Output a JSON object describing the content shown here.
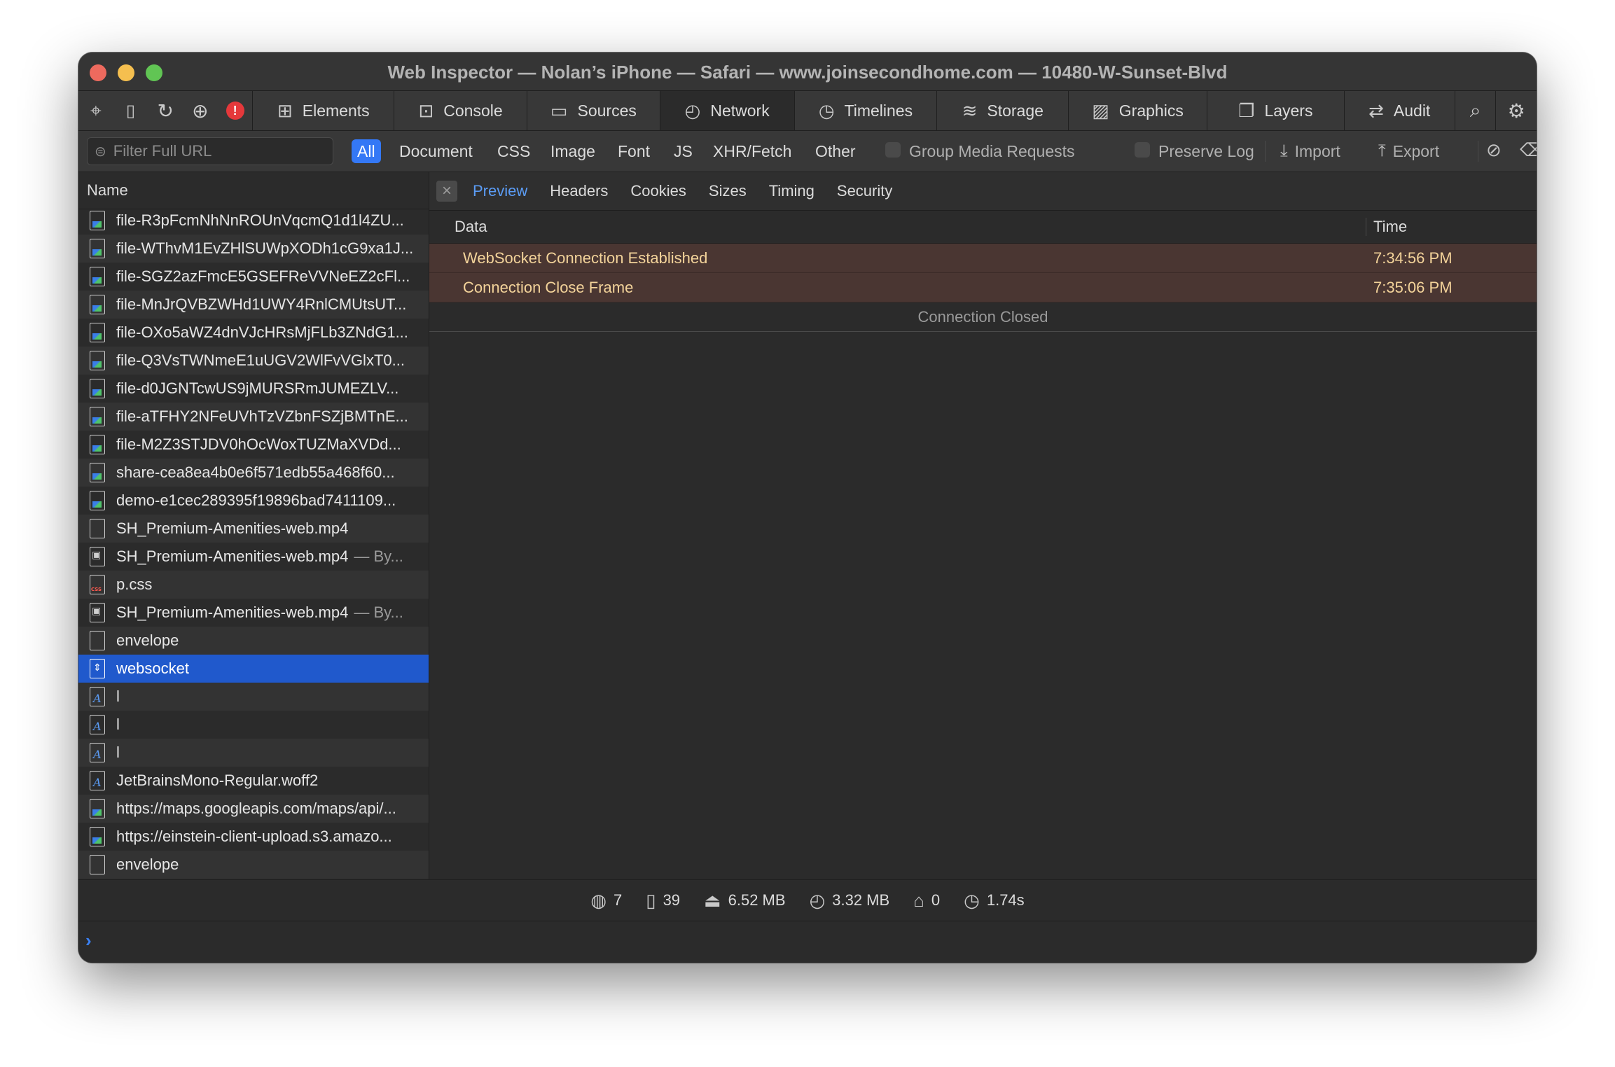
{
  "window": {
    "title": "Web Inspector — Nolan’s iPhone — Safari — www.joinsecondhome.com — 10480-W-Sunset-Blvd"
  },
  "tabs": [
    {
      "label": "Elements",
      "icon": "elements-icon"
    },
    {
      "label": "Console",
      "icon": "console-icon"
    },
    {
      "label": "Sources",
      "icon": "sources-icon"
    },
    {
      "label": "Network",
      "icon": "network-icon",
      "active": true
    },
    {
      "label": "Timelines",
      "icon": "timelines-icon"
    },
    {
      "label": "Storage",
      "icon": "storage-icon"
    },
    {
      "label": "Graphics",
      "icon": "graphics-icon"
    },
    {
      "label": "Layers",
      "icon": "layers-icon"
    },
    {
      "label": "Audit",
      "icon": "audit-icon"
    }
  ],
  "filter": {
    "placeholder": "Filter Full URL",
    "types": [
      "All",
      "Document",
      "CSS",
      "Image",
      "Font",
      "JS",
      "XHR/Fetch",
      "Other"
    ],
    "active_type": "All",
    "group_media": "Group Media Requests",
    "preserve_log": "Preserve Log",
    "import": "Import",
    "export": "Export"
  },
  "list": {
    "header": "Name",
    "rows": [
      {
        "name": "file-R3pFcmNhNnROUnVqcmQ1d1l4ZU...",
        "icon": "image"
      },
      {
        "name": "file-WThvM1EvZHlSUWpXODh1cG9xa1J...",
        "icon": "image"
      },
      {
        "name": "file-SGZ2azFmcE5GSEFReVVNeEZ2cFl...",
        "icon": "image"
      },
      {
        "name": "file-MnJrQVBZWHd1UWY4RnlCMUtsUT...",
        "icon": "image"
      },
      {
        "name": "file-OXo5aWZ4dnVJcHRsMjFLb3ZNdG1...",
        "icon": "image"
      },
      {
        "name": "file-Q3VsTWNmeE1uUGV2WlFvVGlxT0...",
        "icon": "image"
      },
      {
        "name": "file-d0JGNTcwUS9jMURSRmJUMEZLV...",
        "icon": "image"
      },
      {
        "name": "file-aTFHY2NFeUVhTzVZbnFSZjBMTnE...",
        "icon": "image"
      },
      {
        "name": "file-M2Z3STJDV0hOcWoxTUZMaXVDd...",
        "icon": "image"
      },
      {
        "name": "share-cea8ea4b0e6f571edb55a468f60...",
        "icon": "image"
      },
      {
        "name": "demo-e1cec289395f19896bad7411109...",
        "icon": "image"
      },
      {
        "name": "SH_Premium-Amenities-web.mp4",
        "icon": "doc"
      },
      {
        "name": "SH_Premium-Amenities-web.mp4",
        "sub": "— By...",
        "icon": "media"
      },
      {
        "name": "p.css",
        "icon": "css"
      },
      {
        "name": "SH_Premium-Amenities-web.mp4",
        "sub": "— By...",
        "icon": "media"
      },
      {
        "name": "envelope",
        "icon": "doc"
      },
      {
        "name": "websocket",
        "icon": "ws",
        "selected": true
      },
      {
        "name": "l",
        "icon": "font"
      },
      {
        "name": "l",
        "icon": "font"
      },
      {
        "name": "l",
        "icon": "font"
      },
      {
        "name": "JetBrainsMono-Regular.woff2",
        "icon": "font"
      },
      {
        "name": "https://maps.googleapis.com/maps/api/...",
        "icon": "image"
      },
      {
        "name": "https://einstein-client-upload.s3.amazo...",
        "icon": "image"
      },
      {
        "name": "envelope",
        "icon": "doc"
      }
    ]
  },
  "detail": {
    "subtabs": [
      "Preview",
      "Headers",
      "Cookies",
      "Sizes",
      "Timing",
      "Security"
    ],
    "active_subtab": "Preview",
    "columns": {
      "data": "Data",
      "time": "Time"
    },
    "messages": [
      {
        "data": "WebSocket Connection Established",
        "time": "7:34:56 PM"
      },
      {
        "data": "Connection Close Frame",
        "time": "7:35:06 PM"
      }
    ],
    "closed_text": "Connection Closed"
  },
  "status": {
    "domains": "7",
    "resources": "39",
    "size": "6.52 MB",
    "transferred": "3.32 MB",
    "websockets": "0",
    "time": "1.74s"
  },
  "colors": {
    "accent": "#3478f6",
    "selection": "#2059cc",
    "message_row": "#4a3632",
    "message_text": "#f3d39a"
  }
}
